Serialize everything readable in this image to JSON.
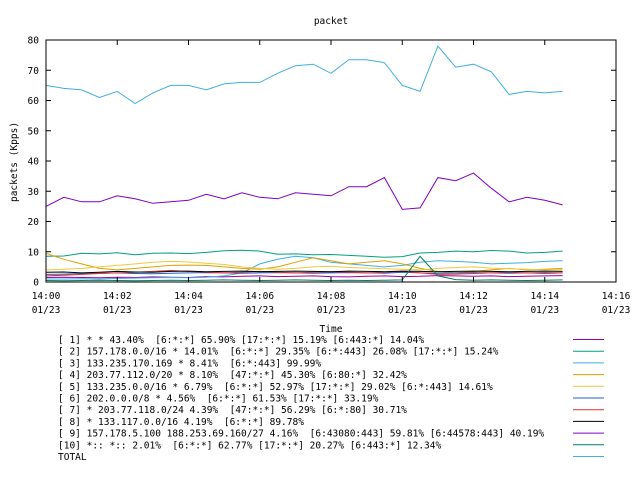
{
  "chart_data": {
    "type": "line",
    "title": "packet",
    "xlabel": "Time",
    "ylabel": "packets (Kpps)",
    "x": [
      "14:00",
      "14:00:30",
      "14:01",
      "14:01:30",
      "14:02",
      "14:02:30",
      "14:03",
      "14:03:30",
      "14:04",
      "14:04:30",
      "14:05",
      "14:05:30",
      "14:06",
      "14:06:30",
      "14:07",
      "14:07:30",
      "14:08",
      "14:08:30",
      "14:09",
      "14:09:30",
      "14:10",
      "14:10:30",
      "14:11",
      "14:11:30",
      "14:12",
      "14:12:30",
      "14:13",
      "14:13:30",
      "14:14",
      "14:14:30"
    ],
    "xlim": [
      "14:00",
      "14:16"
    ],
    "ylim": [
      0,
      80
    ],
    "xticks": [
      {
        "time": "14:00",
        "date": "01/23"
      },
      {
        "time": "14:02",
        "date": "01/23"
      },
      {
        "time": "14:04",
        "date": "01/23"
      },
      {
        "time": "14:06",
        "date": "01/23"
      },
      {
        "time": "14:08",
        "date": "01/23"
      },
      {
        "time": "14:10",
        "date": "01/23"
      },
      {
        "time": "14:12",
        "date": "01/23"
      },
      {
        "time": "14:14",
        "date": "01/23"
      },
      {
        "time": "14:16",
        "date": "01/23"
      }
    ],
    "yticks": [
      "0",
      "10",
      "20",
      "30",
      "40",
      "50",
      "60",
      "70",
      "80"
    ],
    "grid": false,
    "legend_position": "bottom",
    "series": [
      {
        "name": "[ 1] * * 43.40%  [6:*:*] 65.90% [17:*:*] 15.19% [6:443:*] 14.04%",
        "color": "#a000a0",
        "values": [
          1.5,
          1.6,
          1.5,
          1.4,
          1.6,
          1.5,
          1.7,
          1.6,
          1.5,
          1.8,
          1.7,
          1.9,
          2.0,
          1.8,
          1.9,
          2.0,
          1.8,
          1.7,
          1.9,
          2.0,
          1.8,
          1.9,
          2.1,
          2.0,
          1.9,
          2.0,
          1.8,
          1.9,
          2.0,
          2.1
        ]
      },
      {
        "name": "[ 2] 157.178.0.0/16 * 14.01%  [6:*:*] 29.35% [6:*:443] 26.08% [17:*:*] 15.24%",
        "color": "#00a080",
        "values": [
          8.5,
          8.6,
          9.5,
          9.3,
          9.7,
          9.0,
          9.5,
          9.6,
          9.4,
          9.8,
          10.3,
          10.5,
          10.2,
          9.2,
          9.3,
          9.0,
          9.1,
          8.8,
          8.5,
          8.2,
          8.4,
          9.6,
          9.8,
          10.2,
          10.0,
          10.4,
          10.2,
          9.6,
          9.8,
          10.2
        ]
      },
      {
        "name": "[ 3] 133.235.170.169 * 8.41%  [6:*:443] 99.99%",
        "color": "#40b0e0",
        "values": [
          1.0,
          1.0,
          1.1,
          1.0,
          1.2,
          1.3,
          1.4,
          1.5,
          1.4,
          1.6,
          2.0,
          3.0,
          6.0,
          7.5,
          8.5,
          8.0,
          6.5,
          6.0,
          5.5,
          5.0,
          5.5,
          6.5,
          7.0,
          6.8,
          6.5,
          6.0,
          6.2,
          6.4,
          6.8,
          7.0
        ]
      },
      {
        "name": "[ 4] 203.77.112.0/20 * 8.10%  [47:*:*] 45.30% [6:80:*] 32.42%",
        "color": "#e0a000",
        "values": [
          9.5,
          7.5,
          6.0,
          4.5,
          4.0,
          4.5,
          5.0,
          5.5,
          5.6,
          5.5,
          5.0,
          4.5,
          4.2,
          5.0,
          6.5,
          8.0,
          7.0,
          6.0,
          6.5,
          7.0,
          6.0,
          4.5,
          3.5,
          3.0,
          3.5,
          4.0,
          4.5,
          4.0,
          4.2,
          4.5
        ]
      },
      {
        "name": "[ 5] 133.235.0.0/16 * 6.79%  [6:*:*] 52.97% [17:*:*] 29.02% [6:*:443] 14.61%",
        "color": "#f0c840",
        "values": [
          4.0,
          4.2,
          4.5,
          5.0,
          5.5,
          6.0,
          6.5,
          6.8,
          6.6,
          6.2,
          5.8,
          5.0,
          4.5,
          4.2,
          4.5,
          5.0,
          5.2,
          4.8,
          4.6,
          4.4,
          4.2,
          4.0,
          4.5,
          4.8,
          5.0,
          4.6,
          4.4,
          4.2,
          4.0,
          4.1
        ]
      },
      {
        "name": "[ 6] 202.0.0.0/8 * 4.56%  [6:*:*] 61.53% [17:*:*] 33.19%",
        "color": "#2060c0",
        "values": [
          2.5,
          2.6,
          2.8,
          2.9,
          3.0,
          2.8,
          2.7,
          2.9,
          3.0,
          3.1,
          3.0,
          2.9,
          3.0,
          3.1,
          3.0,
          2.9,
          3.0,
          3.1,
          3.0,
          2.9,
          3.2,
          3.0,
          2.9,
          3.0,
          3.1,
          3.0,
          2.9,
          3.0,
          3.1,
          3.0
        ]
      },
      {
        "name": "[ 7] * 203.77.118.0/24 4.39%  [47:*:*] 56.29% [6:*:80] 30.71%",
        "color": "#e03030",
        "values": [
          2.0,
          2.2,
          2.5,
          2.8,
          3.0,
          3.2,
          3.5,
          3.8,
          3.5,
          3.2,
          3.0,
          3.2,
          3.5,
          3.2,
          3.0,
          3.2,
          3.4,
          3.2,
          3.0,
          3.2,
          3.5,
          3.0,
          2.5,
          2.6,
          2.8,
          3.0,
          3.2,
          3.0,
          2.8,
          3.0
        ]
      },
      {
        "name": "[ 8] * 133.117.0.0/16 4.19%  [6:*:*] 89.78%",
        "color": "#000000",
        "values": [
          3.2,
          3.3,
          3.0,
          3.2,
          3.5,
          3.3,
          3.2,
          3.5,
          3.6,
          3.4,
          3.5,
          3.6,
          3.4,
          3.5,
          3.6,
          3.5,
          3.4,
          3.6,
          3.5,
          3.4,
          3.6,
          3.5,
          3.4,
          3.5,
          3.6,
          3.5,
          3.4,
          3.5,
          3.6,
          3.5
        ]
      },
      {
        "name": "[ 9] 157.178.5.100 188.253.69.160/27 4.16%  [6:43080:443] 59.81% [6:44578:443] 40.19%",
        "color": "#8000c0",
        "values": [
          25.0,
          28.0,
          26.5,
          26.5,
          28.5,
          27.5,
          26.0,
          26.5,
          27.0,
          29.0,
          27.5,
          29.5,
          28.0,
          27.5,
          29.5,
          29.0,
          28.5,
          31.5,
          31.5,
          34.5,
          24.0,
          24.5,
          34.5,
          33.5,
          36.0,
          31.0,
          26.5,
          28.0,
          27.0,
          25.5
        ]
      },
      {
        "name": "[10] *:: *:: 2.01%  [6:*:*] 62.77% [17:*:*] 20.27% [6:443:*] 12.34%",
        "color": "#008060",
        "values": [
          0.5,
          0.4,
          0.5,
          0.6,
          0.5,
          0.4,
          0.5,
          0.6,
          0.5,
          0.6,
          0.7,
          0.6,
          0.5,
          0.6,
          0.7,
          0.6,
          0.5,
          0.6,
          0.5,
          0.6,
          0.7,
          8.5,
          2.0,
          0.8,
          0.6,
          0.7,
          0.6,
          0.5,
          0.6,
          0.7
        ]
      },
      {
        "name": "TOTAL",
        "color": "#40b0e0",
        "values": [
          65.0,
          64.0,
          63.5,
          61.0,
          63.0,
          59.0,
          62.5,
          65.0,
          65.0,
          63.5,
          65.5,
          66.0,
          66.0,
          69.0,
          71.5,
          72.0,
          69.0,
          73.5,
          73.5,
          72.5,
          65.0,
          63.0,
          78.0,
          71.0,
          72.0,
          69.5,
          62.0,
          63.0,
          62.5,
          63.0
        ]
      }
    ]
  }
}
